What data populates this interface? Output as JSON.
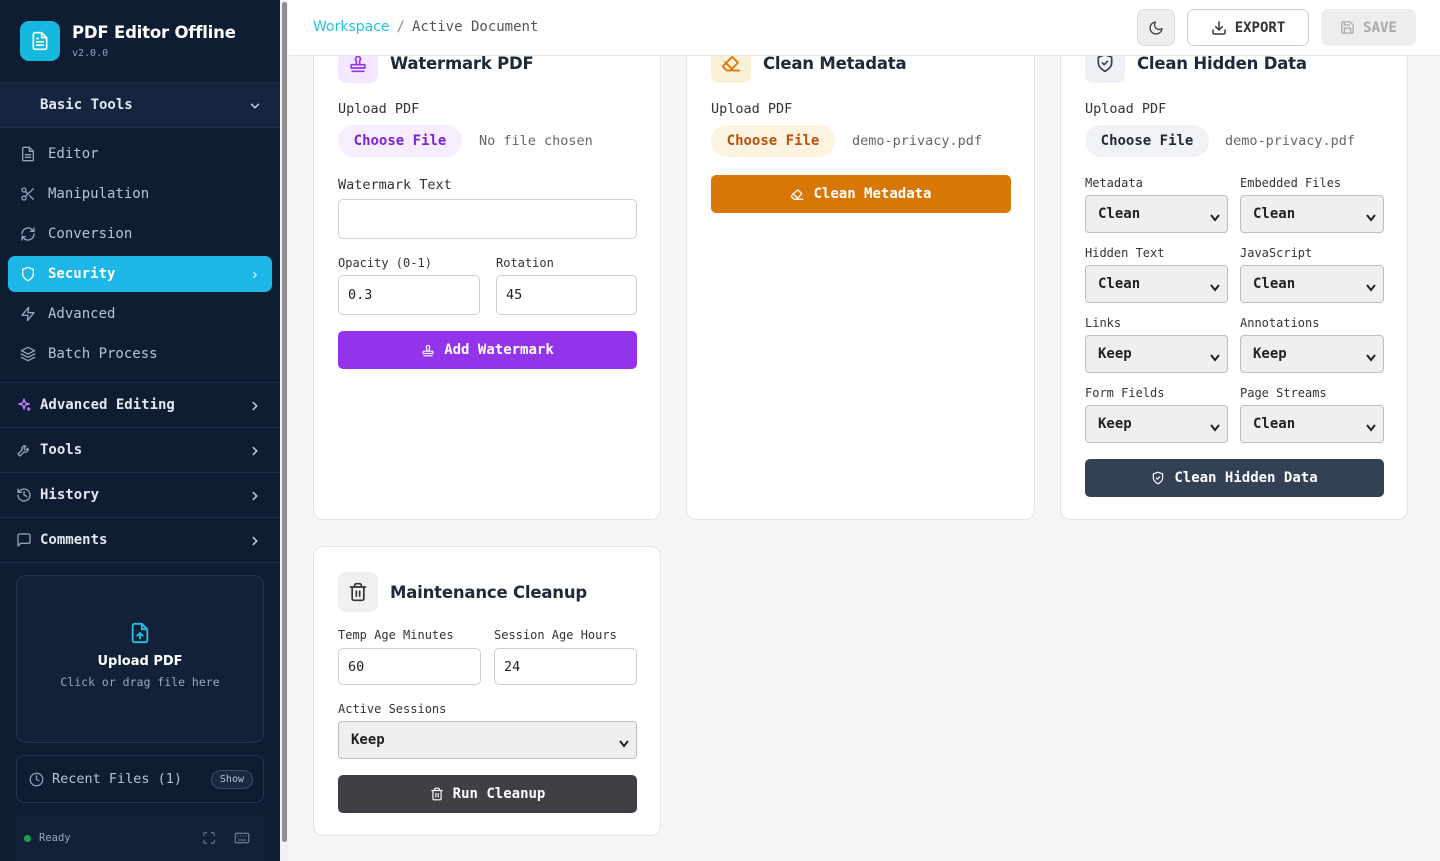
{
  "app": {
    "title": "PDF Editor Offline",
    "version": "v2.0.0"
  },
  "sidebar": {
    "basic_tools": "Basic Tools",
    "items": [
      {
        "label": "Editor"
      },
      {
        "label": "Manipulation"
      },
      {
        "label": "Conversion"
      },
      {
        "label": "Security"
      },
      {
        "label": "Advanced"
      },
      {
        "label": "Batch Process"
      }
    ],
    "sections": [
      {
        "label": "Advanced Editing"
      },
      {
        "label": "Tools"
      },
      {
        "label": "History"
      },
      {
        "label": "Comments"
      }
    ],
    "upload": {
      "title": "Upload PDF",
      "subtitle": "Click or drag file here"
    },
    "recent": {
      "label": "Recent Files (1)",
      "show": "Show"
    },
    "status": "Ready"
  },
  "topbar": {
    "breadcrumb_root": "Workspace",
    "breadcrumb_sep": "/",
    "breadcrumb_current": "Active Document",
    "export_label": "EXPORT",
    "save_label": "SAVE"
  },
  "watermark": {
    "title": "Watermark PDF",
    "upload_label": "Upload PDF",
    "choose_file": "Choose File",
    "file_name": "No file chosen",
    "text_label": "Watermark Text",
    "text_value": "",
    "opacity_label": "Opacity (0-1)",
    "opacity_value": "0.3",
    "rotation_label": "Rotation",
    "rotation_value": "45",
    "button": "Add Watermark"
  },
  "metadata": {
    "title": "Clean Metadata",
    "upload_label": "Upload PDF",
    "choose_file": "Choose File",
    "file_name": "demo-privacy.pdf",
    "button": "Clean Metadata"
  },
  "hidden": {
    "title": "Clean Hidden Data",
    "upload_label": "Upload PDF",
    "choose_file": "Choose File",
    "file_name": "demo-privacy.pdf",
    "fields": [
      {
        "label": "Metadata",
        "value": "Clean"
      },
      {
        "label": "Embedded Files",
        "value": "Clean"
      },
      {
        "label": "Hidden Text",
        "value": "Clean"
      },
      {
        "label": "JavaScript",
        "value": "Clean"
      },
      {
        "label": "Links",
        "value": "Keep"
      },
      {
        "label": "Annotations",
        "value": "Keep"
      },
      {
        "label": "Form Fields",
        "value": "Keep"
      },
      {
        "label": "Page Streams",
        "value": "Clean"
      }
    ],
    "button": "Clean Hidden Data"
  },
  "maintenance": {
    "title": "Maintenance Cleanup",
    "temp_label": "Temp Age Minutes",
    "temp_value": "60",
    "session_label": "Session Age Hours",
    "session_value": "24",
    "active_label": "Active Sessions",
    "active_value": "Keep",
    "button": "Run Cleanup"
  },
  "colors": {
    "accent": "#1cb7e6",
    "watermark": "#9333ea",
    "metadata": "#d97706",
    "hidden": "#334155",
    "cleanup": "#3f3f46"
  }
}
